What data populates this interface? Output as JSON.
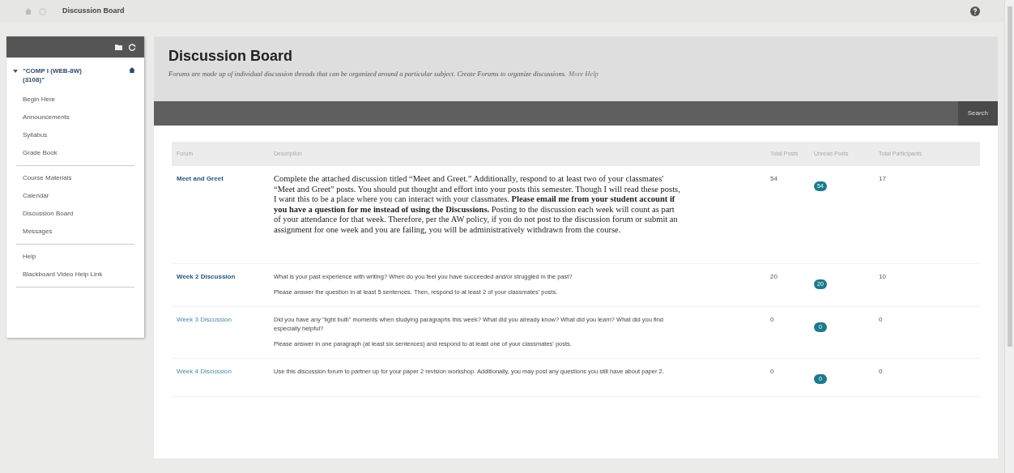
{
  "breadcrumb": {
    "title": "Discussion Board"
  },
  "sidebar": {
    "course": {
      "title": "\"COMP I (WEB-8W) (3108)\"",
      "expanded": true
    },
    "groups": [
      [
        "Begin Here",
        "Announcements",
        "Syllabus",
        "Grade Book"
      ],
      [
        "Course Materials",
        "Calendar",
        "Discussion Board",
        "Messages"
      ],
      [
        "Help",
        "Blackboard Video Help Link"
      ]
    ]
  },
  "page": {
    "title": "Discussion Board",
    "description": "Forums are made up of individual discussion threads that can be organized around a particular subject. Create Forums to organize discussions.",
    "help_link": "More Help"
  },
  "action_bar": {
    "search": "Search"
  },
  "table": {
    "columns": [
      "Forum",
      "Description",
      "Total Posts",
      "Unread Posts",
      "Total Participants"
    ],
    "rows": [
      {
        "forum": "Meet and Greet",
        "bold": true,
        "serif": true,
        "description": [
          "Complete the attached discussion titled “Meet and Greet.” Additionally, respond to at least two of your classmates' “Meet and Greet” posts. You should put thought and effort into your posts this semester.  Though I will read these posts, I want this to be a place where you can interact with your classmates.  **Please email me from your student account if you have a question for me instead of using the Discussions.**  Posting to the discussion each week will count as part of your attendance for that week.  Therefore, per the AW policy, if you do not post to the discussion forum or submit an assignment for one week and you are failing, you will be administratively withdrawn from the course."
        ],
        "total_posts": "54",
        "unread_posts": "54",
        "participants": "17"
      },
      {
        "forum": "Week 2 Discussion",
        "bold": true,
        "serif": false,
        "description": [
          "What is your past experience with writing?  When do you feel you have succeeded and/or struggled in the past?",
          "Please answer the question in at least 5 sentences. Then, respond to at least 2 of your classmates' posts."
        ],
        "total_posts": "20",
        "unread_posts": "20",
        "participants": "10"
      },
      {
        "forum": "Week 3 Discussion",
        "bold": false,
        "serif": false,
        "description": [
          "Did you have any \"light bulb\" moments when studying paragraphs this week?  What did you already know? What did you learn?  What did you find especially helpful?",
          "Please answer in one paragraph (at least six sentences) and respond to at least one of your classmates' posts."
        ],
        "total_posts": "0",
        "unread_posts": "0",
        "participants": "0"
      },
      {
        "forum": "Week 4 Discussion",
        "bold": false,
        "serif": false,
        "description": [
          "Use this discussion forum to partner up for your paper 2 revision workshop. Additionally, you may post any questions you still have about paper 2."
        ],
        "total_posts": "0",
        "unread_posts": "0",
        "participants": "0"
      }
    ]
  }
}
